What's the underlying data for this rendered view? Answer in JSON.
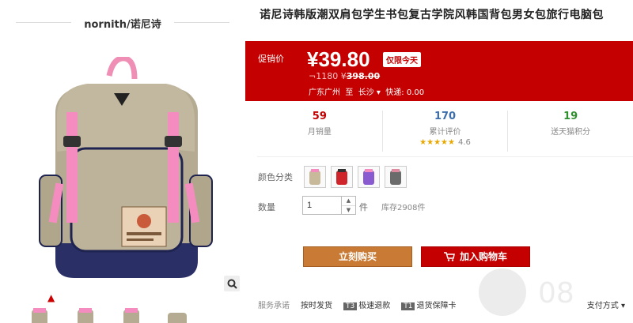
{
  "gallery": {
    "brand": "nornith/诺尼诗"
  },
  "product": {
    "title": "诺尼诗韩版潮双肩包学生书包复古学院风韩国背包男女包旅行电脑包"
  },
  "price_box": {
    "promo_label": "促销价",
    "price": "¥39.80",
    "price_tag": "仅限今天",
    "old_price_prefix": "¬1180 ¥",
    "old_price": "398.00",
    "ship_from": "广东广州",
    "ship_to_label": "至",
    "ship_to": "长沙",
    "shipping": "快递: 0.00"
  },
  "stats": [
    {
      "value": "59",
      "label": "月销量"
    },
    {
      "value": "170",
      "label": "累计评价",
      "rating": "4.6"
    },
    {
      "value": "19",
      "label": "送天猫积分"
    }
  ],
  "options": {
    "color_label": "颜色分类",
    "colors": [
      "#c8b99a",
      "#d0242b",
      "#8a5bd0",
      "#e08aa0"
    ]
  },
  "quantity": {
    "label": "数量",
    "value": "1",
    "unit": "件",
    "stock": "库存2908件"
  },
  "buttons": {
    "buy_now": "立刻购买",
    "add_cart": "加入购物车"
  },
  "service": {
    "label": "服务承诺",
    "items": [
      "按时发货",
      "极速退款",
      "退货保障卡"
    ],
    "badges": [
      "T3",
      "T1"
    ],
    "payment": "支付方式"
  },
  "watermark": "08"
}
